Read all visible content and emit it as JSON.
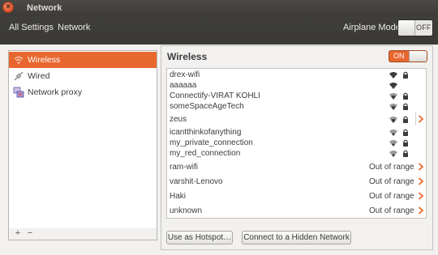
{
  "window": {
    "title": "Network"
  },
  "toolbar": {
    "all_settings": "All Settings",
    "breadcrumb": "Network",
    "airplane_label": "Airplane Mode",
    "airplane_state": "OFF"
  },
  "sidebar": {
    "items": [
      {
        "label": "Wireless",
        "icon": "wireless-icon",
        "selected": true
      },
      {
        "label": "Wired",
        "icon": "wired-icon",
        "selected": false
      },
      {
        "label": "Network proxy",
        "icon": "network-proxy-icon",
        "selected": false
      }
    ],
    "add": "+",
    "remove": "−"
  },
  "main": {
    "title": "Wireless",
    "switch_state": "ON",
    "networks": [
      {
        "name": "drex-wifi",
        "status": "",
        "locked": true
      },
      {
        "name": "aaaaaa",
        "status": "",
        "locked": false
      },
      {
        "name": "Connectify-VIRAT KOHLI",
        "status": "",
        "locked": true
      },
      {
        "name": "someSpaceAgeTech",
        "status": "",
        "locked": true
      },
      {
        "name": "zeus",
        "status": "",
        "locked": true,
        "connected": true
      },
      {
        "name": "icantthinkofanything",
        "status": "",
        "locked": true
      },
      {
        "name": "my_private_connection",
        "status": "",
        "locked": true
      },
      {
        "name": "my_red_connection",
        "status": "",
        "locked": true
      },
      {
        "name": "ram-wifi",
        "status": "Out of range"
      },
      {
        "name": "varshit-Lenovo",
        "status": "Out of range"
      },
      {
        "name": "Haki",
        "status": "Out of range"
      },
      {
        "name": "unknown",
        "status": "Out of range"
      },
      {
        "name": "",
        "status": ""
      }
    ],
    "hotspot_button": "Use as Hotspot…",
    "hidden_button": "Connect to a Hidden Network"
  },
  "colors": {
    "accent": "#e8672f",
    "titlebar": "#3c3b37"
  }
}
